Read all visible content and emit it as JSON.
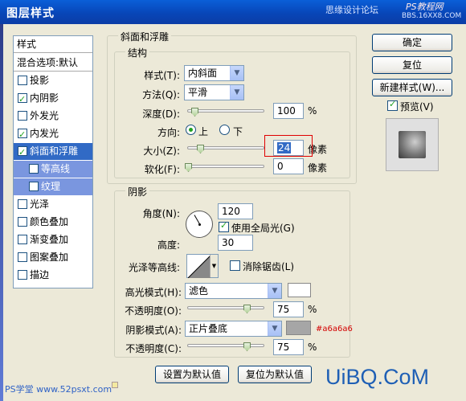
{
  "window": {
    "title": "图层样式",
    "watermark_site": "思缘设计论坛",
    "watermark_ps": "PS教程网",
    "watermark_url": "BBS.16XX8.COM"
  },
  "left_panel": {
    "header": "样式",
    "blend": "混合选项:默认",
    "items": [
      {
        "label": "投影",
        "checked": false
      },
      {
        "label": "内阴影",
        "checked": true
      },
      {
        "label": "外发光",
        "checked": false
      },
      {
        "label": "内发光",
        "checked": true
      },
      {
        "label": "斜面和浮雕",
        "checked": true,
        "selected": true
      },
      {
        "label": "等高线",
        "checked": false,
        "sub": true
      },
      {
        "label": "纹理",
        "checked": false,
        "sub": true
      },
      {
        "label": "光泽",
        "checked": false
      },
      {
        "label": "颜色叠加",
        "checked": false
      },
      {
        "label": "渐变叠加",
        "checked": false
      },
      {
        "label": "图案叠加",
        "checked": false
      },
      {
        "label": "描边",
        "checked": false
      }
    ]
  },
  "bevel": {
    "section_title": "斜面和浮雕",
    "structure_title": "结构",
    "style_label": "样式(T):",
    "style_value": "内斜面",
    "technique_label": "方法(Q):",
    "technique_value": "平滑",
    "depth_label": "深度(D):",
    "depth_value": "100",
    "depth_unit": "%",
    "direction_label": "方向:",
    "direction_up": "上",
    "direction_down": "下",
    "size_label": "大小(Z):",
    "size_value": "24",
    "size_unit": "像素",
    "soften_label": "软化(F):",
    "soften_value": "0",
    "soften_unit": "像素"
  },
  "shading": {
    "title": "阴影",
    "angle_label": "角度(N):",
    "angle_value": "120",
    "global_light_label": "使用全局光(G)",
    "altitude_label": "高度:",
    "altitude_value": "30",
    "gloss_label": "光泽等高线:",
    "antialias_label": "消除锯齿(L)",
    "highlight_label": "高光模式(H):",
    "highlight_mode": "滤色",
    "highlight_color": "#ffffff",
    "highlight_opacity_label": "不透明度(O):",
    "highlight_opacity": "75",
    "shadow_label": "阴影模式(A):",
    "shadow_mode": "正片叠底",
    "shadow_color": "#a6a6a6",
    "shadow_color_note": "#a6a6a6",
    "shadow_opacity_label": "不透明度(C):",
    "shadow_opacity": "75",
    "percent": "%"
  },
  "bottom_buttons": {
    "set_default": "设置为默认值",
    "reset_default": "复位为默认值"
  },
  "right_buttons": {
    "ok": "确定",
    "reset": "复位",
    "new_style": "新建样式(W)...",
    "preview_label": "预览(V)"
  },
  "footer": {
    "uibq": "UiBQ.CoM",
    "psxt": "PS学堂 www.52psxt.com"
  }
}
